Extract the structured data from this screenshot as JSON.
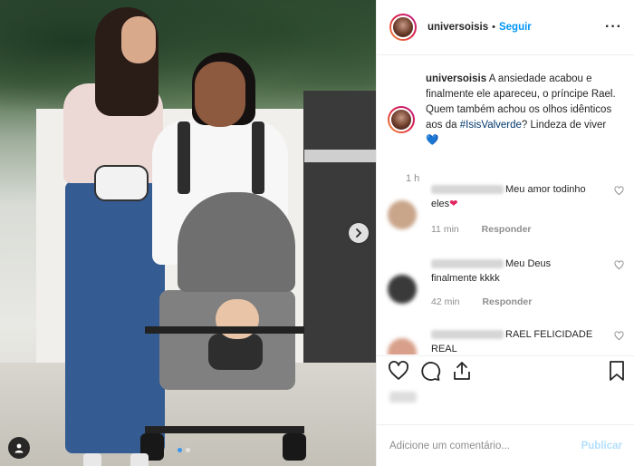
{
  "post": {
    "username": "universoisis",
    "separator": "•",
    "follow_label": "Seguir",
    "more_label": "···",
    "caption_user": "universoisis",
    "caption_text_1": "A ansiedade acabou e finalmente ele apareceu, o príncipe Rael. Quem também achou os olhos idênticos aos da",
    "caption_hashtag": "#IsisValverde",
    "caption_text_2": "? Lindeza de viver",
    "caption_emoji": "💙",
    "caption_time": "1 h"
  },
  "comments": [
    {
      "text": "Meu amor todinho eles",
      "emoji": "❤",
      "time": "11 min",
      "reply": "Responder",
      "avatar_color": "#c9a58a"
    },
    {
      "text": "Meu Deus finalmente kkkk",
      "emoji": "",
      "time": "42 min",
      "reply": "Responder",
      "avatar_color": "#3a3a3a"
    },
    {
      "text": "RAEL FELICIDADE REAL",
      "emoji": "",
      "time": "",
      "reply": "",
      "avatar_color": "#d8a08a"
    }
  ],
  "icons": {
    "like": "heart-icon",
    "comment": "comment-icon",
    "share": "share-icon",
    "save": "bookmark-icon",
    "next": "chevron-right-icon",
    "tag": "user-tag-icon"
  },
  "add_comment": {
    "placeholder": "Adicione um comentário...",
    "post_label": "Publicar"
  },
  "carousel": {
    "count": 2,
    "active": 0
  },
  "colors": {
    "link": "#0095f6",
    "hashtag": "#00376b",
    "muted": "#8e8e8e",
    "post_disabled": "#b2dffc"
  }
}
